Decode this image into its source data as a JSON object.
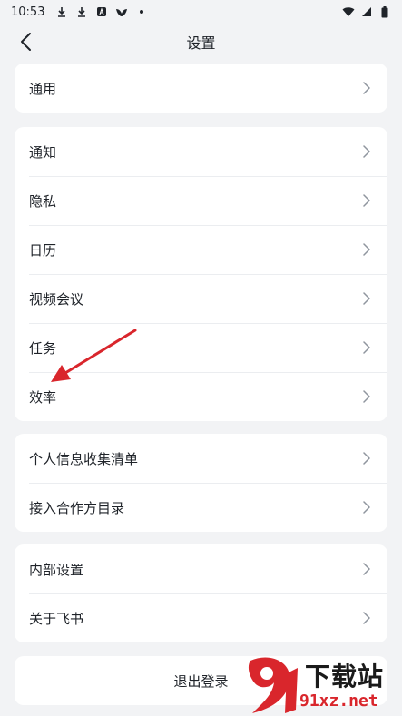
{
  "status_bar": {
    "time": "10:53",
    "left_icons": [
      "download-icon",
      "download-icon",
      "a-badge-icon",
      "bird-icon",
      "dot-icon"
    ],
    "right_icons": [
      "wifi-icon",
      "signal-icon",
      "battery-icon"
    ]
  },
  "header": {
    "title": "设置"
  },
  "groups": [
    {
      "items": [
        {
          "label": "通用"
        }
      ]
    },
    {
      "items": [
        {
          "label": "通知"
        },
        {
          "label": "隐私"
        },
        {
          "label": "日历"
        },
        {
          "label": "视频会议"
        },
        {
          "label": "任务"
        },
        {
          "label": "效率"
        }
      ]
    },
    {
      "items": [
        {
          "label": "个人信息收集清单"
        },
        {
          "label": "接入合作方目录"
        }
      ]
    },
    {
      "items": [
        {
          "label": "内部设置"
        },
        {
          "label": "关于飞书"
        }
      ]
    }
  ],
  "logout": {
    "label": "退出登录"
  },
  "watermark": {
    "title": "下载站",
    "url": "91xz.net"
  },
  "colors": {
    "background": "#f2f3f5",
    "card": "#ffffff",
    "arrow": "#d9262c",
    "text": "#1f2329",
    "chevron": "#8f959e"
  }
}
